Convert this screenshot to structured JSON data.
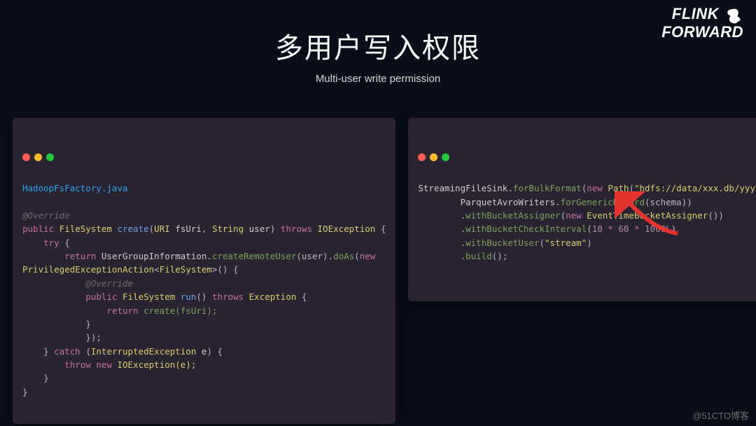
{
  "logo": {
    "line1": "FLINK",
    "line2": "FORWARD"
  },
  "title": {
    "main": "多用户写入权限",
    "sub": "Multi-user write permission"
  },
  "watermark": "@51CTO博客",
  "left": {
    "file": "HadoopFsFactory.java",
    "anno1": "@Override",
    "kw_public": "public",
    "ty_FileSystem": "FileSystem",
    "m_create": "create",
    "p_open": "(",
    "ty_URI": "URI",
    "id_fsUri": " fsUri",
    "comma": ", ",
    "ty_String": "String",
    "id_user": " user",
    "p_close": ")",
    "kw_throws": "throws",
    "ty_IOException": "IOException",
    "brace_o": " {",
    "kw_try": "try",
    "kw_return": "return",
    "id_UGI": " UserGroupInformation",
    "dot": ".",
    "m_createRemoteUser": "createRemoteUser",
    "arg_user": "(user)",
    "m_doAs": "doAs",
    "kw_new": "new",
    "ty_PEA": "PrivilegedExceptionAction",
    "lt": "<",
    "gt": ">",
    "empty_call": "() {",
    "anno2": "@Override",
    "m_run": "run",
    "empty_paren": "()",
    "ty_Exception": "Exception",
    "ret_create": " create(fsUri);",
    "close_inner": "            });",
    "kw_catch": "catch",
    "catch_args": " (",
    "ty_IE": "InterruptedException",
    "id_e": " e",
    "kw_throw": "throw",
    "new_ioe": " IOException(e);",
    "brace_c": "}"
  },
  "right": {
    "id_SFS": "StreamingFileSink",
    "dot": ".",
    "m_forBulk": "forBulkFormat",
    "p_open": "(",
    "kw_new": "new",
    "ty_Path": " Path",
    "str_path": "\"hdfs://data/xxx.db/yyyy/\"",
    "p_close": ")",
    "comma": ",",
    "id_PAW": "        ParquetAvroWriters",
    "m_forGen": "forGenericRecord",
    "arg_schema": "(schema))",
    "m_withBA": "withBucketAssigner",
    "ty_ETBA": " EventTimeBucketAssigner",
    "empty_call": "())",
    "m_withBCI": "withBucketCheckInterval",
    "num_10": "10",
    "op_mul": " * ",
    "num_60": "60",
    "num_1000L": "1000L",
    "m_withBU": "withBucketUser",
    "str_stream": "\"stream\"",
    "m_build": "build",
    "build_call": "();"
  }
}
